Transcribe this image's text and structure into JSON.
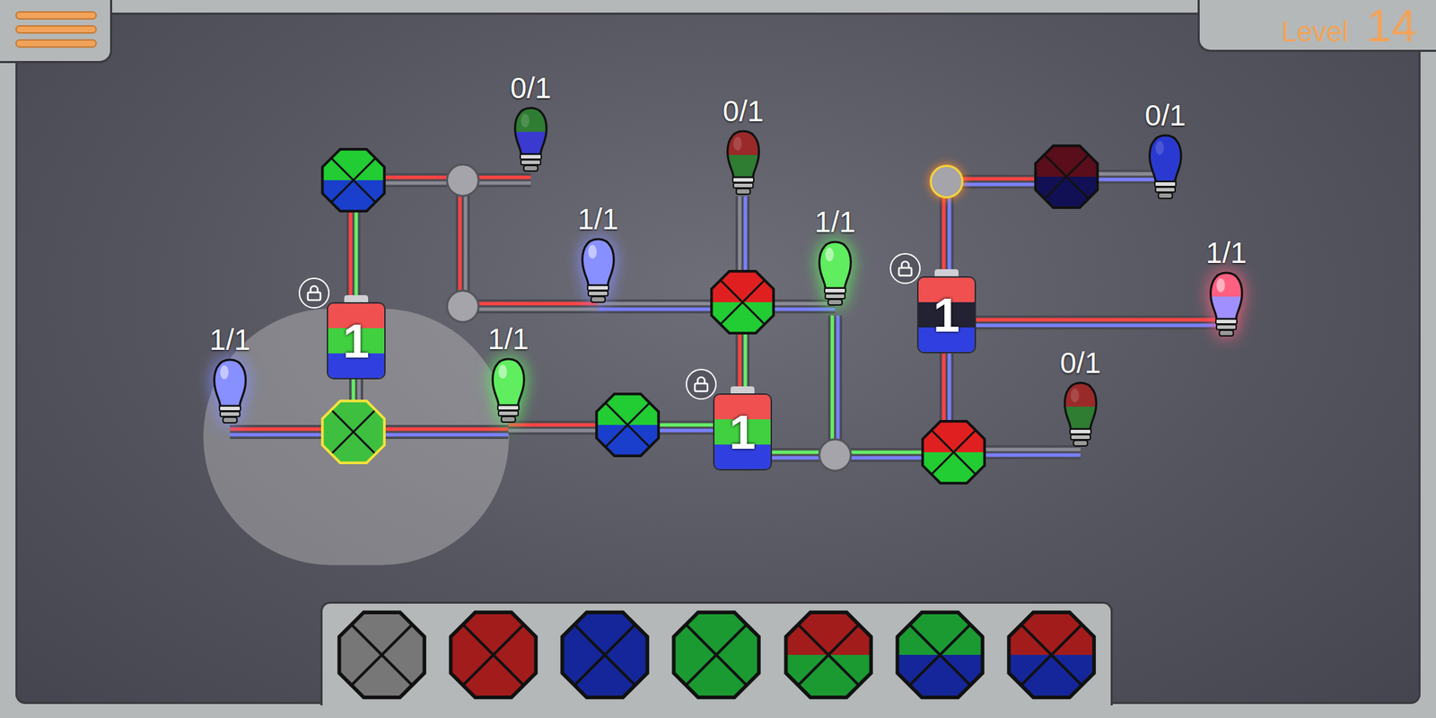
{
  "level": {
    "label": "Level",
    "number": "14"
  },
  "filters": [
    {
      "colors": [
        "#22cc33",
        "#1a3fcc"
      ],
      "selected": false
    },
    {
      "colors": [
        "#3fbf3f",
        "#3fbf3f"
      ],
      "selected": true
    },
    {
      "colors": [
        "#22cc33",
        "#1a3fcc"
      ],
      "selected": false
    },
    {
      "colors": [
        "#e02020",
        "#22cc33"
      ],
      "selected": false
    },
    {
      "colors": [
        "#e02020",
        "#22cc33"
      ],
      "selected": false
    },
    {
      "colors": [
        "#5a0d1a",
        "#121055"
      ],
      "selected": false
    }
  ],
  "junctions": [
    {
      "selected": false
    },
    {
      "selected": false
    },
    {
      "selected": false
    },
    {
      "selected": true
    }
  ],
  "batteries": [
    {
      "charge": "1",
      "locked": true,
      "colors": [
        "#f05050",
        "#40d040",
        "#3040e0"
      ]
    },
    {
      "charge": "1",
      "locked": true,
      "colors": [
        "#f05050",
        "#40d040",
        "#3040e0"
      ]
    },
    {
      "charge": "1",
      "locked": true,
      "colors": [
        "#f05050",
        "#222233",
        "#3040e0"
      ]
    }
  ],
  "bulbs": [
    {
      "count": "0/1",
      "lit": false,
      "colors": [
        "#2e7d32",
        "#3a3ad0"
      ]
    },
    {
      "count": "0/1",
      "lit": false,
      "colors": [
        "#9a2a2a",
        "#2e7d32"
      ]
    },
    {
      "count": "0/1",
      "lit": false,
      "colors": [
        "#2a3ad0",
        "#2a3ad0"
      ]
    },
    {
      "count": "1/1",
      "lit": true,
      "colors": [
        "#8890ff",
        "#8890ff"
      ]
    },
    {
      "count": "1/1",
      "lit": true,
      "colors": [
        "#60ee60",
        "#60ee60"
      ]
    },
    {
      "count": "1/1",
      "lit": true,
      "colors": [
        "#ff6080",
        "#a090ff"
      ]
    },
    {
      "count": "1/1",
      "lit": true,
      "colors": [
        "#8890ff",
        "#8890ff"
      ]
    },
    {
      "count": "1/1",
      "lit": true,
      "colors": [
        "#60ee60",
        "#60ee60"
      ]
    },
    {
      "count": "0/1",
      "lit": false,
      "colors": [
        "#9a2a2a",
        "#2e7d32"
      ]
    }
  ],
  "wires": [
    {
      "colors": [
        "#ff4444",
        "#8a8a94"
      ]
    },
    {
      "colors": [
        "#ff4444",
        "#8a8a94"
      ]
    },
    {
      "colors": [
        "#ff4444",
        "#8a8a94"
      ]
    },
    {
      "colors": [
        "#ff4444",
        "#8a8a94"
      ]
    },
    {
      "colors": [
        "#8a8a94",
        "#7a80ff"
      ]
    },
    {
      "colors": [
        "#8a8a94",
        "#7a80ff"
      ]
    },
    {
      "colors": [
        "#8a8a94",
        "#7a80ff"
      ]
    },
    {
      "colors": [
        "#ff4444",
        "#66ee66"
      ]
    },
    {
      "colors": [
        "#ff4444",
        "#66ee66"
      ]
    },
    {
      "colors": [
        "#66ee66",
        "#8a8a94"
      ]
    },
    {
      "colors": [
        "#ff4444",
        "#7a80ff"
      ]
    },
    {
      "colors": [
        "#ff4444",
        "#7a80ff"
      ]
    },
    {
      "colors": [
        "#ff4444",
        "#8a8a94"
      ]
    },
    {
      "colors": [
        "#66ee66",
        "#7a80ff"
      ]
    },
    {
      "colors": [
        "#66ee66",
        "#7a80ff"
      ]
    },
    {
      "colors": [
        "#66ee66",
        "#7a80ff"
      ]
    },
    {
      "colors": [
        "#66ee66",
        "#7a80ff"
      ]
    },
    {
      "colors": [
        "#8a8a94",
        "#7a80ff"
      ]
    },
    {
      "colors": [
        "#ff4444",
        "#7a80ff"
      ]
    },
    {
      "colors": [
        "#ff4444",
        "#7a80ff"
      ]
    },
    {
      "colors": [
        "#ff4444",
        "#7a80ff"
      ]
    },
    {
      "colors": [
        "#8a8a94",
        "#7a80ff"
      ]
    },
    {
      "colors": [
        "#ff4444",
        "#7a80ff"
      ]
    }
  ],
  "palette": [
    {
      "colors": [
        "#777777",
        "#777777"
      ]
    },
    {
      "colors": [
        "#a31c1c",
        "#a31c1c"
      ]
    },
    {
      "colors": [
        "#15269a",
        "#15269a"
      ]
    },
    {
      "colors": [
        "#1b9a32",
        "#1b9a32"
      ]
    },
    {
      "colors": [
        "#a31c1c",
        "#1b9a32"
      ]
    },
    {
      "colors": [
        "#1b9a32",
        "#15269a"
      ]
    },
    {
      "colors": [
        "#a31c1c",
        "#15269a"
      ]
    }
  ]
}
